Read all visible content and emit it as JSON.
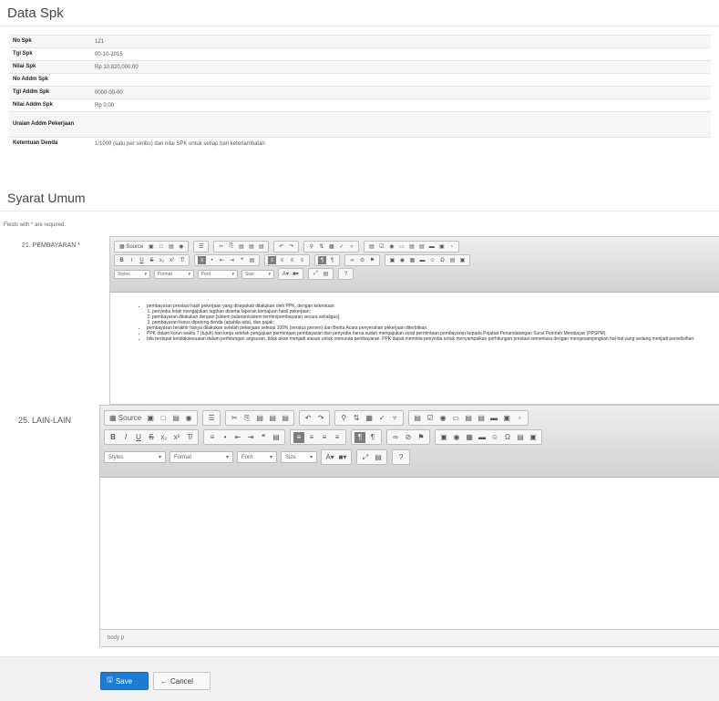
{
  "data_spk": {
    "title": "Data Spk",
    "rows": [
      {
        "label": "No Spk",
        "value": "121"
      },
      {
        "label": "Tgl Spk",
        "value": "00-10-2015"
      },
      {
        "label": "Nilai Spk",
        "value": "Rp 10.820.000,00"
      },
      {
        "label": "No Addm Spk",
        "value": ""
      },
      {
        "label": "Tgl Addm Spk",
        "value": "0000-00-00"
      },
      {
        "label": "Nilai Addm Spk",
        "value": "Rp 0,00"
      },
      {
        "label": "Uraian Addm Pekerjaan",
        "value": ""
      },
      {
        "label": "Ketentuan Denda",
        "value": "1/1000 (satu per seribu) dari nilai SPK untuk setiap hari keterlambatan"
      }
    ]
  },
  "syarat_umum": {
    "title": "Syarat Umum",
    "required_note": "Fields with * are required.",
    "field1": {
      "label": "21. PEMBAYARAN *",
      "content": [
        "pembayaran prestasi hasil pekerjaan yang disepakati dilakukan oleh PPK, dengan ketentuan:",
        "penyedia telah mengajukan tagihan disertai laporan kemajuan hasil pekerjaan;",
        "pembayaran dilakukan dengan [sistem bulanan/sistem termin/pembayaran secara sekaligus];",
        "pembayaran harus dipotong denda (apabila ada), dan pajak;",
        "pembayaran terakhir hanya dilakukan setelah pekerjaan selesai 100% (seratus persen) dan Berita Acara penyerahan pekerjaan diterbitkan.",
        "PPK dalam kurun waktu 7 (tujuh) hari kerja setelah pengajuan permintaan pembayaran dari penyedia harus sudah mengajukan surat permintaan pembayaran kepada Pejabat Penandatangan Surat Perintah Membayar (PPSPM).",
        "bila terdapat ketidaksesuaian dalam perhitungan angsuran, tidak akan menjadi alasan untuk menunda pembayaran. PPK dapat meminta penyedia untuk menyampaikan perhitungan prestasi sementara dengan mengesampingkan hal-hal yang sedang menjadi perselisihan."
      ]
    },
    "field2": {
      "label": "25. LAIN-LAIN",
      "path": "body p"
    }
  },
  "toolbar": {
    "source": "Source",
    "combos": [
      "Styles",
      "Format",
      "Font",
      "Size"
    ],
    "styles_value2": "Styles",
    "help": "?"
  },
  "actions": {
    "save": "Save",
    "cancel": "Cancel"
  },
  "colors": {
    "primary": "#1f7ad2",
    "footer": "#f2f2f2"
  }
}
